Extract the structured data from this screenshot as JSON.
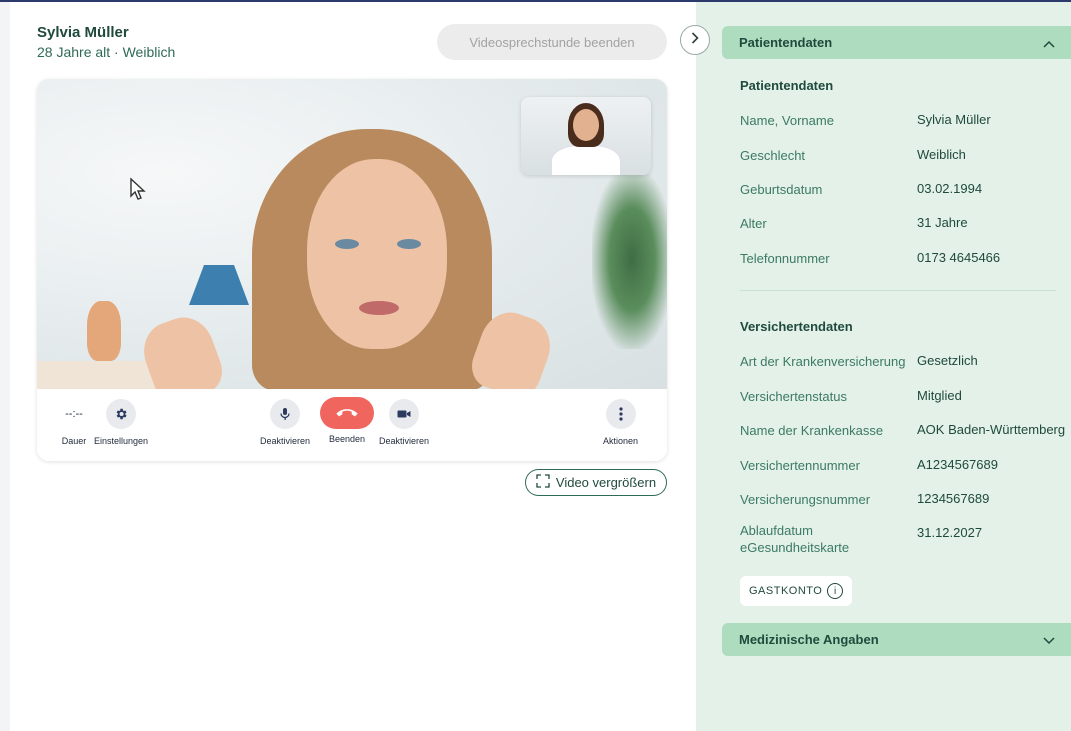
{
  "patient": {
    "name": "Sylvia Müller",
    "subtitle": "28 Jahre alt · Weiblich"
  },
  "header": {
    "end_consultation_label": "Videosprechstunde beenden"
  },
  "video": {
    "controls": {
      "timer_value": "--:--",
      "duration_label": "Dauer",
      "settings_label": "Einstellungen",
      "mic_label": "Deaktivieren",
      "hangup_label": "Beenden",
      "camera_label": "Deaktivieren",
      "actions_label": "Aktionen"
    },
    "enlarge_label": "Video vergrößern"
  },
  "sidebar": {
    "patient_section": {
      "header": "Patientendaten",
      "title": "Patientendaten",
      "rows": [
        {
          "label": "Name, Vorname",
          "value": "Sylvia Müller"
        },
        {
          "label": "Geschlecht",
          "value": "Weiblich"
        },
        {
          "label": "Geburtsdatum",
          "value": "03.02.1994"
        },
        {
          "label": "Alter",
          "value": "31 Jahre"
        },
        {
          "label": "Telefonnummer",
          "value": "0173 4645466"
        }
      ]
    },
    "insurance_section": {
      "title": "Versichertendaten",
      "rows": [
        {
          "label": "Art der Krankenversicherung",
          "value": "Gesetzlich"
        },
        {
          "label": "Versichertenstatus",
          "value": "Mitglied"
        },
        {
          "label": "Name der Krankenkasse",
          "value": "AOK Baden-Württemberg"
        },
        {
          "label": "Versichertennummer",
          "value": "A1234567689"
        },
        {
          "label": "Versicherungsnummer",
          "value": "1234567689"
        },
        {
          "label": "Ablaufdatum eGesundheitskarte",
          "value": "31.12.2027"
        }
      ]
    },
    "guest_badge": "GASTKONTO",
    "medical_section": {
      "header": "Medizinische Angaben"
    }
  },
  "icons": {
    "collapse": "chevron-right-icon",
    "settings": "gear-icon",
    "mic": "microphone-icon",
    "hangup": "phone-hangup-icon",
    "camera": "video-camera-icon",
    "actions": "more-vertical-icon",
    "enlarge": "expand-icon",
    "info": "info-icon"
  },
  "colors": {
    "accent_green": "#aedcbf",
    "panel_bg": "#e3f1e8",
    "hangup_red": "#f0665f",
    "text_dark_green": "#1f4a3d"
  }
}
